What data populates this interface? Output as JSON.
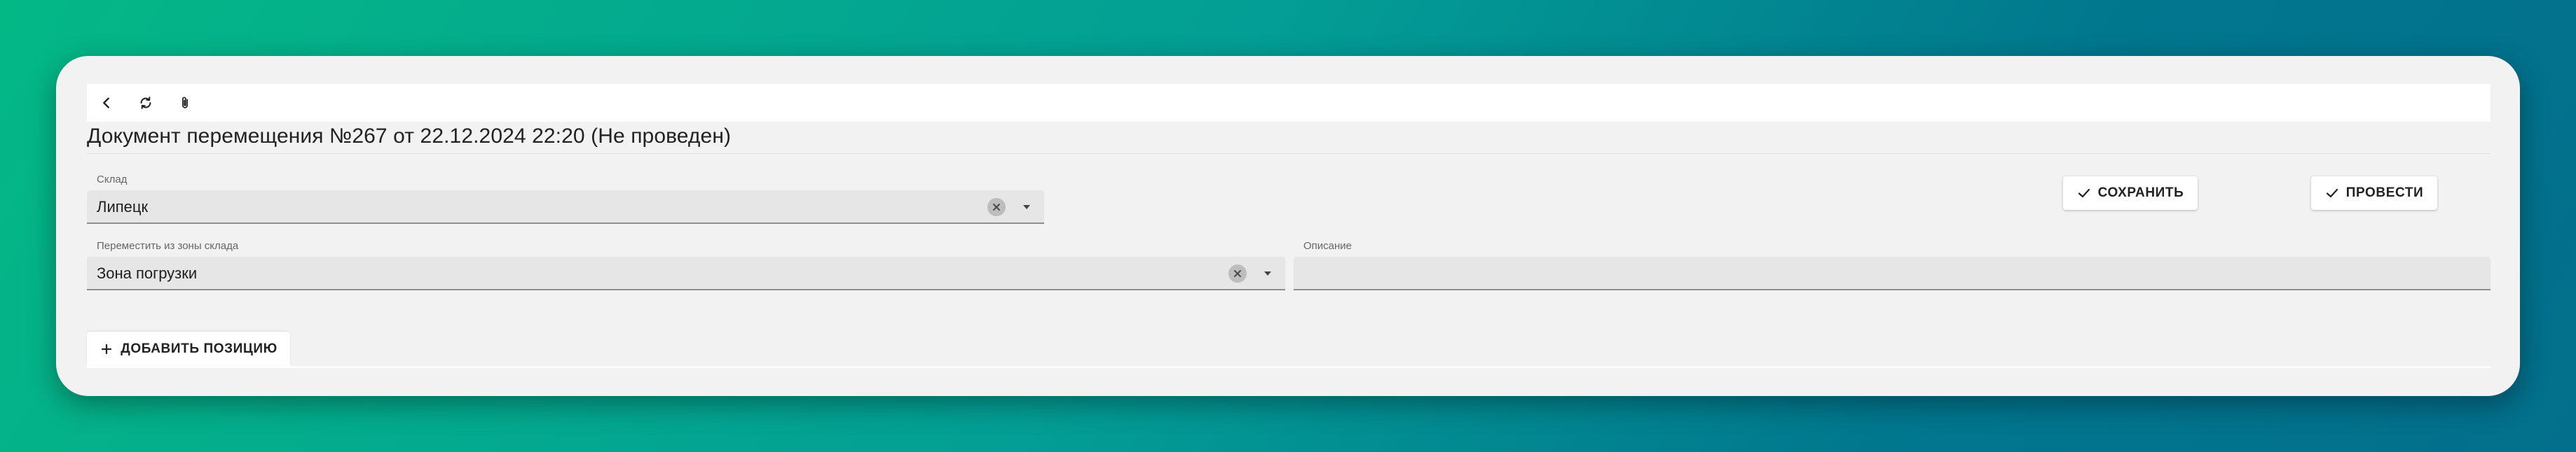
{
  "toolbar": {
    "back_icon": "chevron-left-icon",
    "refresh_icon": "refresh-icon",
    "attach_icon": "paperclip-icon"
  },
  "document": {
    "title": "Документ перемещения №267 от 22.12.2024 22:20 (Не проведен)"
  },
  "fields": {
    "warehouse": {
      "label": "Склад",
      "value": "Липецк"
    },
    "zone": {
      "label": "Переместить из зоны склада",
      "value": "Зона погрузки"
    },
    "description": {
      "label": "Описание",
      "value": ""
    }
  },
  "actions": {
    "save_label": "СОХРАНИТЬ",
    "post_label": "ПРОВЕСТИ",
    "add_position_label": "ДОБАВИТЬ ПОЗИЦИЮ"
  },
  "colors": {
    "background_start": "#04b886",
    "background_end": "#036f8c",
    "panel": "#f2f2f2"
  }
}
